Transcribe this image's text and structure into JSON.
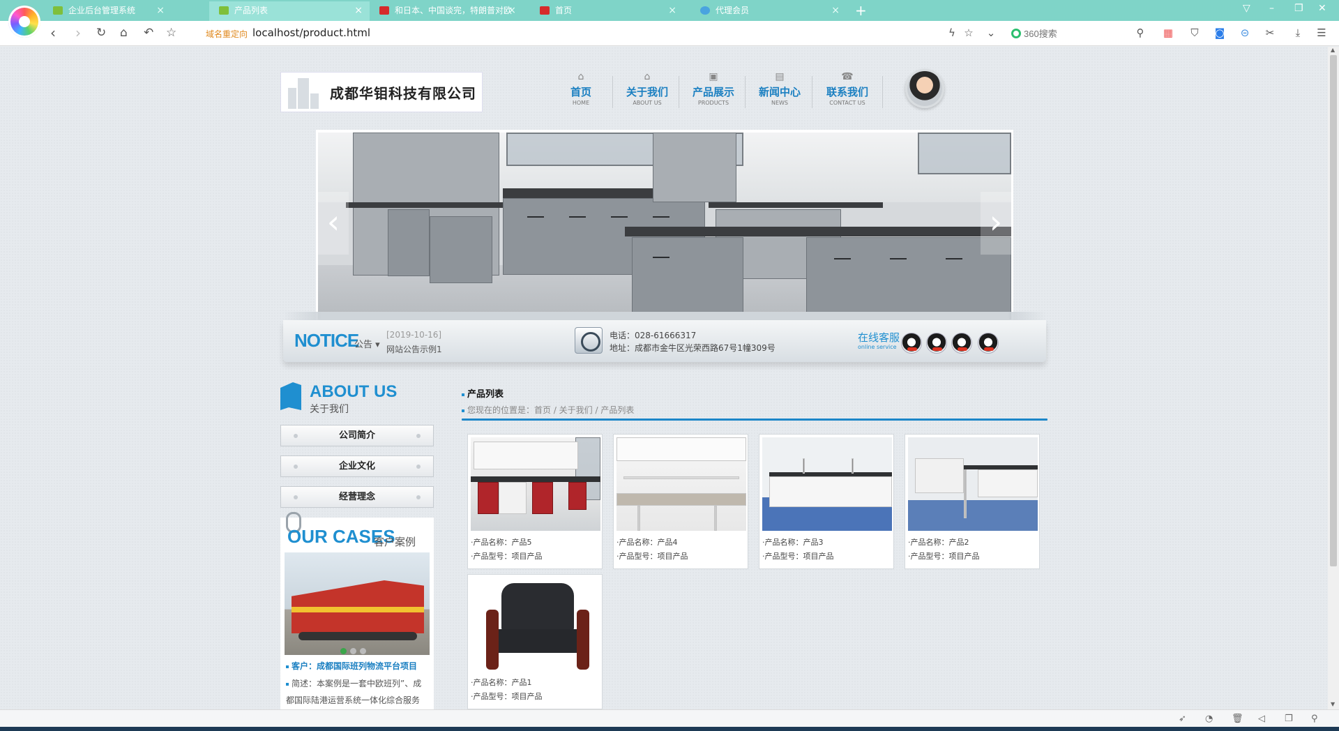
{
  "browser": {
    "tabs": [
      {
        "title": "企业后台管理系统",
        "active": false,
        "icon_color": "#7fbf3a"
      },
      {
        "title": "产品列表",
        "active": true,
        "icon_color": "#7fbf3a"
      },
      {
        "title": "和日本、中国谈完，特朗普对欧",
        "active": false,
        "icon_color": "#d62b2b"
      },
      {
        "title": "首页",
        "active": false,
        "icon_color": "#d62b2b"
      },
      {
        "title": "代理会员",
        "active": false,
        "icon_color": "#4aa3df"
      }
    ],
    "redirect_label": "域名重定向",
    "url": "localhost/product.html",
    "search_placeholder": "360搜索"
  },
  "site": {
    "company_name": "成都华钼科技有限公司",
    "nav": [
      {
        "cn": "首页",
        "en": "HOME",
        "icon": "home-icon"
      },
      {
        "cn": "关于我们",
        "en": "ABOUT US",
        "icon": "about-icon"
      },
      {
        "cn": "产品展示",
        "en": "PRODUCTS",
        "icon": "products-icon"
      },
      {
        "cn": "新闻中心",
        "en": "NEWS",
        "icon": "news-icon"
      },
      {
        "cn": "联系我们",
        "en": "CONTACT US",
        "icon": "phone-icon"
      }
    ],
    "banner": {
      "prev": "‹",
      "next": "›"
    },
    "notice": {
      "title": "NOTICE",
      "sub": "公告",
      "date": "[2019-10-16]",
      "text": "网站公告示例1"
    },
    "contact": {
      "phone": "电话：028-61666317",
      "address": "地址：成都市金牛区光荣西路67号1幢309号"
    },
    "online_service": {
      "cn": "在线客服",
      "en": "online service"
    },
    "about": {
      "title_en": "ABOUT US",
      "title_cn": "关于我们",
      "menu": [
        "公司简介",
        "企业文化",
        "经营理念"
      ]
    },
    "cases": {
      "title_en": "OUR CASES",
      "title_cn": "客户案例",
      "client": "客户：成都国际班列物流平台项目",
      "description": "简述：本案例是一套中欧班列”、成都国际陆港运营系统一体化综合服务"
    },
    "breadcrumb": {
      "title": "产品列表",
      "path": "您现在的位置是：首页 / 关于我们 / 产品列表"
    },
    "products": [
      {
        "name": "·产品名称：产品5",
        "model": "·产品型号：项目产品"
      },
      {
        "name": "·产品名称：产品4",
        "model": "·产品型号：项目产品"
      },
      {
        "name": "·产品名称：产品3",
        "model": "·产品型号：项目产品"
      },
      {
        "name": "·产品名称：产品2",
        "model": "·产品型号：项目产品"
      },
      {
        "name": "·产品名称：产品1",
        "model": "·产品型号：项目产品"
      }
    ]
  },
  "colors": {
    "accent": "#1f8fd0",
    "tabbar": "#7fd4c8"
  }
}
